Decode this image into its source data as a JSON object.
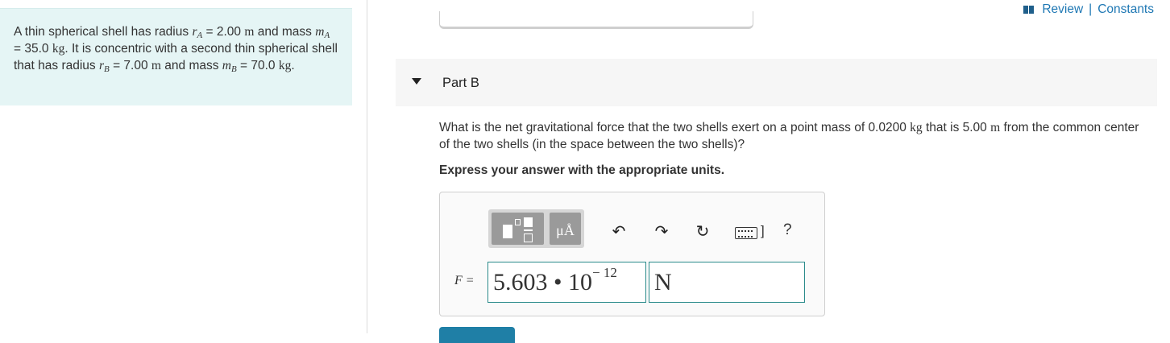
{
  "problem": {
    "t1": "A thin spherical shell has radius ",
    "rA_sym": "r",
    "rA_sub": "A",
    "eq1": " = 2.00 ",
    "u_m1": "m",
    "t2": " and mass ",
    "mA_sym": "m",
    "mA_sub": "A",
    "eq2": " = 35.0 ",
    "u_kg1": "kg",
    "t3": ". It is concentric with a second thin spherical shell that has radius ",
    "rB_sym": "r",
    "rB_sub": "B",
    "eq3": " = 7.00 ",
    "u_m2": "m",
    "t4": " and mass ",
    "mB_sym": "m",
    "mB_sub": "B",
    "eq4": " = 70.0 ",
    "u_kg2": "kg",
    "t5": "."
  },
  "header": {
    "review": "Review",
    "separator": "|",
    "constants": "Constants"
  },
  "part": {
    "title": "Part B"
  },
  "question": {
    "t1": "What is the net gravitational force that the two shells exert on a point mass of 0.0200 ",
    "u_kg": "kg",
    "t2": " that is 5.00 ",
    "u_m": "m",
    "t3": " from the common center of the two shells (in the space between the two shells)?"
  },
  "instruction": "Express your answer with the appropriate units.",
  "toolbar": {
    "units_label": "μÅ",
    "undo_icon": "↶",
    "redo_icon": "↷",
    "reset_icon": "↻",
    "kb_bracket": "]",
    "help": "?"
  },
  "answer": {
    "label": "F =",
    "mantissa": "5.603 • 10",
    "exponent": "− 12",
    "unit": "N"
  },
  "colors": {
    "panel_bg": "#e5f5f5",
    "link": "#1f78b4",
    "input_border": "#2a8a8a",
    "submit": "#1f7fa6"
  }
}
